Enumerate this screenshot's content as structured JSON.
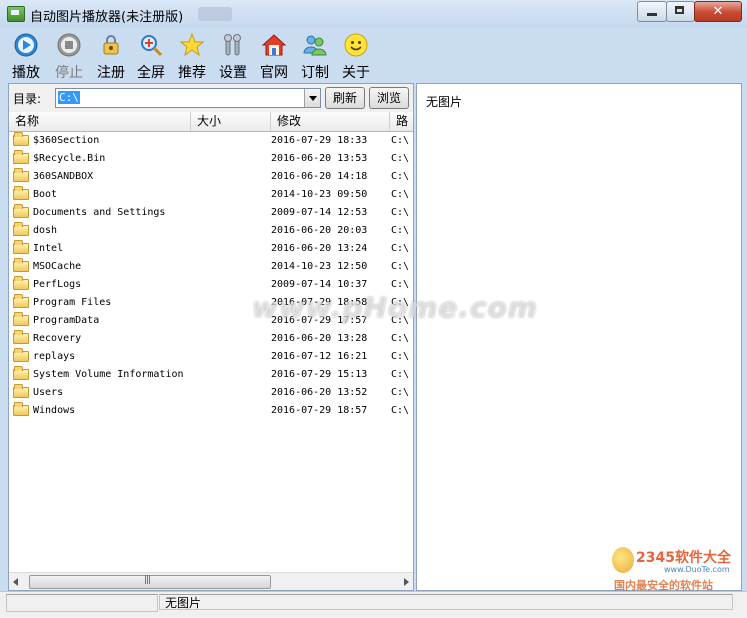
{
  "window": {
    "title": "自动图片播放器(未注册版)"
  },
  "toolbar": {
    "items": [
      {
        "label": "播放",
        "icon": "play-icon",
        "enabled": true
      },
      {
        "label": "停止",
        "icon": "stop-icon",
        "enabled": false
      },
      {
        "label": "注册",
        "icon": "register-lock-icon",
        "enabled": true
      },
      {
        "label": "全屏",
        "icon": "fullscreen-magnifier-icon",
        "enabled": true
      },
      {
        "label": "推荐",
        "icon": "star-icon",
        "enabled": true
      },
      {
        "label": "设置",
        "icon": "wrench-settings-icon",
        "enabled": true
      },
      {
        "label": "官网",
        "icon": "home-icon",
        "enabled": true
      },
      {
        "label": "订制",
        "icon": "users-icon",
        "enabled": true
      },
      {
        "label": "关于",
        "icon": "smiley-icon",
        "enabled": true
      }
    ]
  },
  "directory": {
    "label": "目录:",
    "value": "C:\\",
    "refresh_label": "刷新",
    "browse_label": "浏览"
  },
  "file_list": {
    "columns": [
      "名称",
      "大小",
      "修改",
      "路径"
    ],
    "rows": [
      {
        "name": "$360Section",
        "modified": "2016-07-29 18:33",
        "path": "C:\\"
      },
      {
        "name": "$Recycle.Bin",
        "modified": "2016-06-20 13:53",
        "path": "C:\\"
      },
      {
        "name": "360SANDBOX",
        "modified": "2016-06-20 14:18",
        "path": "C:\\"
      },
      {
        "name": "Boot",
        "modified": "2014-10-23 09:50",
        "path": "C:\\"
      },
      {
        "name": "Documents and Settings",
        "modified": "2009-07-14 12:53",
        "path": "C:\\"
      },
      {
        "name": "dosh",
        "modified": "2016-06-20 20:03",
        "path": "C:\\"
      },
      {
        "name": "Intel",
        "modified": "2016-06-20 13:24",
        "path": "C:\\"
      },
      {
        "name": "MSOCache",
        "modified": "2014-10-23 12:50",
        "path": "C:\\"
      },
      {
        "name": "PerfLogs",
        "modified": "2009-07-14 10:37",
        "path": "C:\\"
      },
      {
        "name": "Program Files",
        "modified": "2016-07-29 18:58",
        "path": "C:\\"
      },
      {
        "name": "ProgramData",
        "modified": "2016-07-29 17:57",
        "path": "C:\\"
      },
      {
        "name": "Recovery",
        "modified": "2016-06-20 13:28",
        "path": "C:\\"
      },
      {
        "name": "replays",
        "modified": "2016-07-12 16:21",
        "path": "C:\\"
      },
      {
        "name": "System Volume Information",
        "modified": "2016-07-29 15:13",
        "path": "C:\\"
      },
      {
        "name": "Users",
        "modified": "2016-06-20 13:52",
        "path": "C:\\"
      },
      {
        "name": "Windows",
        "modified": "2016-07-29 18:57",
        "path": "C:\\"
      }
    ]
  },
  "preview": {
    "text": "无图片"
  },
  "statusbar": {
    "text": "无图片"
  },
  "watermark": {
    "text": "www.pHome.com"
  },
  "brand": {
    "logo": "2345软件大全",
    "url": "www.DuoTe.com",
    "slogan": "国内最安全的软件站"
  },
  "colors": {
    "accent": "#3399ff",
    "close_button": "#c74b32",
    "window_frame": "#c9dcf0"
  }
}
